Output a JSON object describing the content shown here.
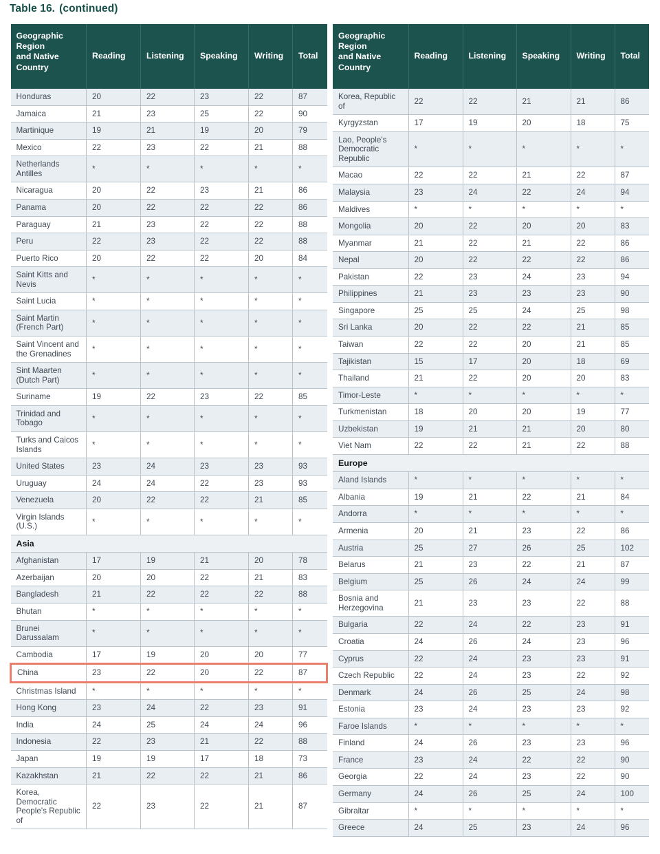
{
  "title": {
    "label": "Table 16.",
    "suffix": "(continued)"
  },
  "columns": [
    "Geographic Region and Native Country",
    "Reading",
    "Listening",
    "Speaking",
    "Writing",
    "Total"
  ],
  "header_multiline": [
    "Geographic",
    "Region",
    "and Native",
    "Country"
  ],
  "colors": {
    "header_bg": "#1d534e",
    "title_text": "#17514b",
    "row_alt_bg": "#e9eef3",
    "section_bg": "#eef1f4",
    "grid_line": "#b9c3cb",
    "highlight_border": "#ea7f6d"
  },
  "footnote_symbol": "*",
  "left_table": {
    "rows": [
      {
        "type": "data",
        "name": "Honduras",
        "reading": "20",
        "listening": "22",
        "speaking": "23",
        "writing": "22",
        "total": "87"
      },
      {
        "type": "data",
        "name": "Jamaica",
        "reading": "21",
        "listening": "23",
        "speaking": "25",
        "writing": "22",
        "total": "90"
      },
      {
        "type": "data",
        "name": "Martinique",
        "reading": "19",
        "listening": "21",
        "speaking": "19",
        "writing": "20",
        "total": "79"
      },
      {
        "type": "data",
        "name": "Mexico",
        "reading": "22",
        "listening": "23",
        "speaking": "22",
        "writing": "21",
        "total": "88"
      },
      {
        "type": "data",
        "name": "Netherlands Antilles",
        "reading": "*",
        "listening": "*",
        "speaking": "*",
        "writing": "*",
        "total": "*"
      },
      {
        "type": "data",
        "name": "Nicaragua",
        "reading": "20",
        "listening": "22",
        "speaking": "23",
        "writing": "21",
        "total": "86"
      },
      {
        "type": "data",
        "name": "Panama",
        "reading": "20",
        "listening": "22",
        "speaking": "22",
        "writing": "22",
        "total": "86"
      },
      {
        "type": "data",
        "name": "Paraguay",
        "reading": "21",
        "listening": "23",
        "speaking": "22",
        "writing": "22",
        "total": "88"
      },
      {
        "type": "data",
        "name": "Peru",
        "reading": "22",
        "listening": "23",
        "speaking": "22",
        "writing": "22",
        "total": "88"
      },
      {
        "type": "data",
        "name": "Puerto Rico",
        "reading": "20",
        "listening": "22",
        "speaking": "22",
        "writing": "20",
        "total": "84"
      },
      {
        "type": "data",
        "name": "Saint Kitts and Nevis",
        "reading": "*",
        "listening": "*",
        "speaking": "*",
        "writing": "*",
        "total": "*"
      },
      {
        "type": "data",
        "name": "Saint Lucia",
        "reading": "*",
        "listening": "*",
        "speaking": "*",
        "writing": "*",
        "total": "*"
      },
      {
        "type": "data",
        "name": "Saint Martin (French Part)",
        "reading": "*",
        "listening": "*",
        "speaking": "*",
        "writing": "*",
        "total": "*"
      },
      {
        "type": "data",
        "name": "Saint Vincent and the Grenadines",
        "reading": "*",
        "listening": "*",
        "speaking": "*",
        "writing": "*",
        "total": "*"
      },
      {
        "type": "data",
        "name": "Sint Maarten (Dutch Part)",
        "reading": "*",
        "listening": "*",
        "speaking": "*",
        "writing": "*",
        "total": "*"
      },
      {
        "type": "data",
        "name": "Suriname",
        "reading": "19",
        "listening": "22",
        "speaking": "23",
        "writing": "22",
        "total": "85"
      },
      {
        "type": "data",
        "name": "Trinidad and Tobago",
        "reading": "*",
        "listening": "*",
        "speaking": "*",
        "writing": "*",
        "total": "*"
      },
      {
        "type": "data",
        "name": "Turks and Caicos Islands",
        "reading": "*",
        "listening": "*",
        "speaking": "*",
        "writing": "*",
        "total": "*"
      },
      {
        "type": "data",
        "name": "United States",
        "reading": "23",
        "listening": "24",
        "speaking": "23",
        "writing": "23",
        "total": "93"
      },
      {
        "type": "data",
        "name": "Uruguay",
        "reading": "24",
        "listening": "24",
        "speaking": "22",
        "writing": "23",
        "total": "93"
      },
      {
        "type": "data",
        "name": "Venezuela",
        "reading": "20",
        "listening": "22",
        "speaking": "22",
        "writing": "21",
        "total": "85"
      },
      {
        "type": "data",
        "name": "Virgin Islands (U.S.)",
        "reading": "*",
        "listening": "*",
        "speaking": "*",
        "writing": "*",
        "total": "*"
      },
      {
        "type": "section",
        "name": "Asia"
      },
      {
        "type": "data",
        "name": "Afghanistan",
        "reading": "17",
        "listening": "19",
        "speaking": "21",
        "writing": "20",
        "total": "78"
      },
      {
        "type": "data",
        "name": "Azerbaijan",
        "reading": "20",
        "listening": "20",
        "speaking": "22",
        "writing": "21",
        "total": "83"
      },
      {
        "type": "data",
        "name": "Bangladesh",
        "reading": "21",
        "listening": "22",
        "speaking": "22",
        "writing": "22",
        "total": "88"
      },
      {
        "type": "data",
        "name": "Bhutan",
        "reading": "*",
        "listening": "*",
        "speaking": "*",
        "writing": "*",
        "total": "*"
      },
      {
        "type": "data",
        "name": "Brunei Darussalam",
        "reading": "*",
        "listening": "*",
        "speaking": "*",
        "writing": "*",
        "total": "*"
      },
      {
        "type": "data",
        "name": "Cambodia",
        "reading": "17",
        "listening": "19",
        "speaking": "20",
        "writing": "20",
        "total": "77"
      },
      {
        "type": "data",
        "name": "China",
        "reading": "23",
        "listening": "22",
        "speaking": "20",
        "writing": "22",
        "total": "87",
        "highlighted": true
      },
      {
        "type": "data",
        "name": "Christmas Island",
        "reading": "*",
        "listening": "*",
        "speaking": "*",
        "writing": "*",
        "total": "*"
      },
      {
        "type": "data",
        "name": "Hong Kong",
        "reading": "23",
        "listening": "24",
        "speaking": "22",
        "writing": "23",
        "total": "91"
      },
      {
        "type": "data",
        "name": "India",
        "reading": "24",
        "listening": "25",
        "speaking": "24",
        "writing": "24",
        "total": "96"
      },
      {
        "type": "data",
        "name": "Indonesia",
        "reading": "22",
        "listening": "23",
        "speaking": "21",
        "writing": "22",
        "total": "88"
      },
      {
        "type": "data",
        "name": "Japan",
        "reading": "19",
        "listening": "19",
        "speaking": "17",
        "writing": "18",
        "total": "73"
      },
      {
        "type": "data",
        "name": "Kazakhstan",
        "reading": "21",
        "listening": "22",
        "speaking": "22",
        "writing": "21",
        "total": "86"
      },
      {
        "type": "data",
        "name": "Korea, Democratic People's Republic of",
        "reading": "22",
        "listening": "23",
        "speaking": "22",
        "writing": "21",
        "total": "87"
      }
    ]
  },
  "right_table": {
    "rows": [
      {
        "type": "data",
        "name": "Korea, Republic of",
        "reading": "22",
        "listening": "22",
        "speaking": "21",
        "writing": "21",
        "total": "86"
      },
      {
        "type": "data",
        "name": "Kyrgyzstan",
        "reading": "17",
        "listening": "19",
        "speaking": "20",
        "writing": "18",
        "total": "75"
      },
      {
        "type": "data",
        "name": "Lao, People's Democratic Republic",
        "reading": "*",
        "listening": "*",
        "speaking": "*",
        "writing": "*",
        "total": "*"
      },
      {
        "type": "data",
        "name": "Macao",
        "reading": "22",
        "listening": "22",
        "speaking": "21",
        "writing": "22",
        "total": "87"
      },
      {
        "type": "data",
        "name": "Malaysia",
        "reading": "23",
        "listening": "24",
        "speaking": "22",
        "writing": "24",
        "total": "94"
      },
      {
        "type": "data",
        "name": "Maldives",
        "reading": "*",
        "listening": "*",
        "speaking": "*",
        "writing": "*",
        "total": "*"
      },
      {
        "type": "data",
        "name": "Mongolia",
        "reading": "20",
        "listening": "22",
        "speaking": "20",
        "writing": "20",
        "total": "83"
      },
      {
        "type": "data",
        "name": "Myanmar",
        "reading": "21",
        "listening": "22",
        "speaking": "21",
        "writing": "22",
        "total": "86"
      },
      {
        "type": "data",
        "name": "Nepal",
        "reading": "20",
        "listening": "22",
        "speaking": "22",
        "writing": "22",
        "total": "86"
      },
      {
        "type": "data",
        "name": "Pakistan",
        "reading": "22",
        "listening": "23",
        "speaking": "24",
        "writing": "23",
        "total": "94"
      },
      {
        "type": "data",
        "name": "Philippines",
        "reading": "21",
        "listening": "23",
        "speaking": "23",
        "writing": "23",
        "total": "90"
      },
      {
        "type": "data",
        "name": "Singapore",
        "reading": "25",
        "listening": "25",
        "speaking": "24",
        "writing": "25",
        "total": "98"
      },
      {
        "type": "data",
        "name": "Sri Lanka",
        "reading": "20",
        "listening": "22",
        "speaking": "22",
        "writing": "21",
        "total": "85"
      },
      {
        "type": "data",
        "name": "Taiwan",
        "reading": "22",
        "listening": "22",
        "speaking": "20",
        "writing": "21",
        "total": "85"
      },
      {
        "type": "data",
        "name": "Tajikistan",
        "reading": "15",
        "listening": "17",
        "speaking": "20",
        "writing": "18",
        "total": "69"
      },
      {
        "type": "data",
        "name": "Thailand",
        "reading": "21",
        "listening": "22",
        "speaking": "20",
        "writing": "20",
        "total": "83"
      },
      {
        "type": "data",
        "name": "Timor-Leste",
        "reading": "*",
        "listening": "*",
        "speaking": "*",
        "writing": "*",
        "total": "*"
      },
      {
        "type": "data",
        "name": "Turkmenistan",
        "reading": "18",
        "listening": "20",
        "speaking": "20",
        "writing": "19",
        "total": "77"
      },
      {
        "type": "data",
        "name": "Uzbekistan",
        "reading": "19",
        "listening": "21",
        "speaking": "21",
        "writing": "20",
        "total": "80"
      },
      {
        "type": "data",
        "name": "Viet Nam",
        "reading": "22",
        "listening": "22",
        "speaking": "21",
        "writing": "22",
        "total": "88"
      },
      {
        "type": "section",
        "name": "Europe"
      },
      {
        "type": "data",
        "name": "Aland Islands",
        "reading": "*",
        "listening": "*",
        "speaking": "*",
        "writing": "*",
        "total": "*"
      },
      {
        "type": "data",
        "name": "Albania",
        "reading": "19",
        "listening": "21",
        "speaking": "22",
        "writing": "21",
        "total": "84"
      },
      {
        "type": "data",
        "name": "Andorra",
        "reading": "*",
        "listening": "*",
        "speaking": "*",
        "writing": "*",
        "total": "*"
      },
      {
        "type": "data",
        "name": "Armenia",
        "reading": "20",
        "listening": "21",
        "speaking": "23",
        "writing": "22",
        "total": "86"
      },
      {
        "type": "data",
        "name": "Austria",
        "reading": "25",
        "listening": "27",
        "speaking": "26",
        "writing": "25",
        "total": "102"
      },
      {
        "type": "data",
        "name": "Belarus",
        "reading": "21",
        "listening": "23",
        "speaking": "22",
        "writing": "21",
        "total": "87"
      },
      {
        "type": "data",
        "name": "Belgium",
        "reading": "25",
        "listening": "26",
        "speaking": "24",
        "writing": "24",
        "total": "99"
      },
      {
        "type": "data",
        "name": "Bosnia and Herzegovina",
        "reading": "21",
        "listening": "23",
        "speaking": "23",
        "writing": "22",
        "total": "88"
      },
      {
        "type": "data",
        "name": "Bulgaria",
        "reading": "22",
        "listening": "24",
        "speaking": "22",
        "writing": "23",
        "total": "91"
      },
      {
        "type": "data",
        "name": "Croatia",
        "reading": "24",
        "listening": "26",
        "speaking": "24",
        "writing": "23",
        "total": "96"
      },
      {
        "type": "data",
        "name": "Cyprus",
        "reading": "22",
        "listening": "24",
        "speaking": "23",
        "writing": "23",
        "total": "91"
      },
      {
        "type": "data",
        "name": "Czech Republic",
        "reading": "22",
        "listening": "24",
        "speaking": "23",
        "writing": "22",
        "total": "92"
      },
      {
        "type": "data",
        "name": "Denmark",
        "reading": "24",
        "listening": "26",
        "speaking": "25",
        "writing": "24",
        "total": "98"
      },
      {
        "type": "data",
        "name": "Estonia",
        "reading": "23",
        "listening": "24",
        "speaking": "23",
        "writing": "23",
        "total": "92"
      },
      {
        "type": "data",
        "name": "Faroe Islands",
        "reading": "*",
        "listening": "*",
        "speaking": "*",
        "writing": "*",
        "total": "*"
      },
      {
        "type": "data",
        "name": "Finland",
        "reading": "24",
        "listening": "26",
        "speaking": "23",
        "writing": "23",
        "total": "96"
      },
      {
        "type": "data",
        "name": "France",
        "reading": "23",
        "listening": "24",
        "speaking": "22",
        "writing": "22",
        "total": "90"
      },
      {
        "type": "data",
        "name": "Georgia",
        "reading": "22",
        "listening": "24",
        "speaking": "23",
        "writing": "22",
        "total": "90"
      },
      {
        "type": "data",
        "name": "Germany",
        "reading": "24",
        "listening": "26",
        "speaking": "25",
        "writing": "24",
        "total": "100"
      },
      {
        "type": "data",
        "name": "Gibraltar",
        "reading": "*",
        "listening": "*",
        "speaking": "*",
        "writing": "*",
        "total": "*"
      },
      {
        "type": "data",
        "name": "Greece",
        "reading": "24",
        "listening": "25",
        "speaking": "23",
        "writing": "24",
        "total": "96"
      }
    ]
  }
}
